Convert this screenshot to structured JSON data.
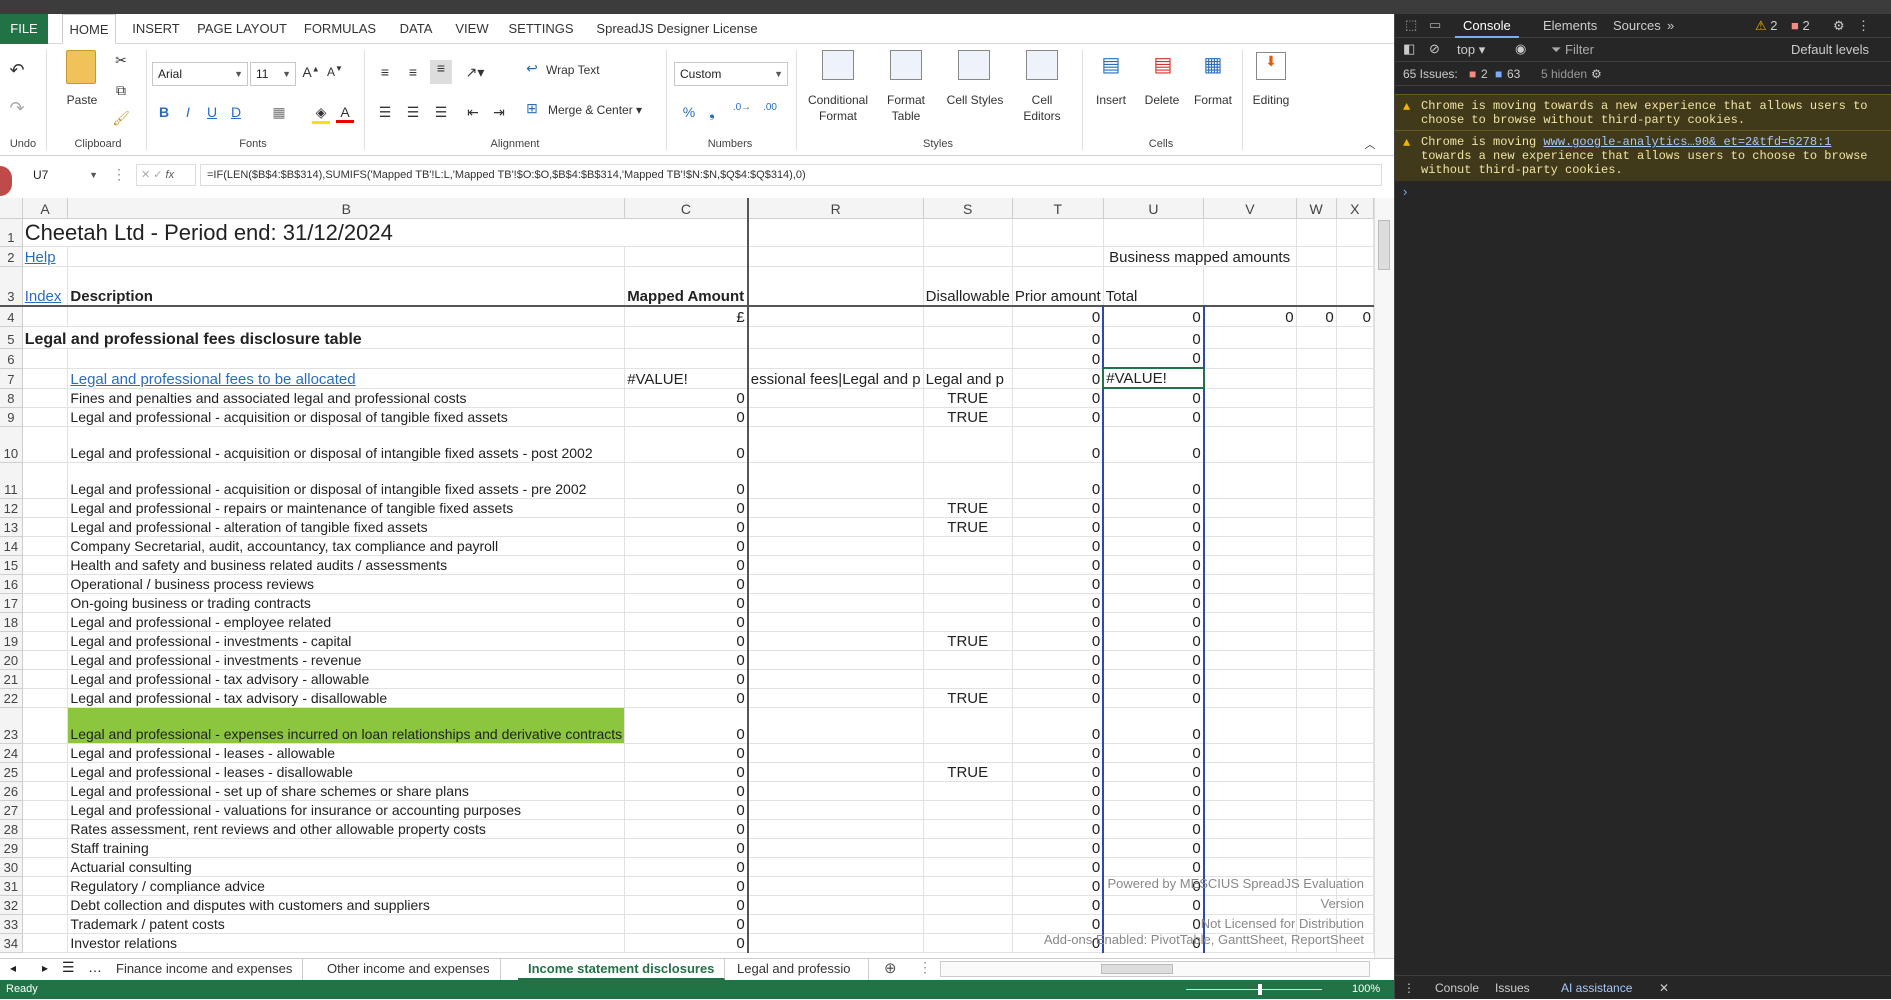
{
  "ribbon": {
    "file": "FILE",
    "tabs": [
      "HOME",
      "INSERT",
      "PAGE LAYOUT",
      "FORMULAS",
      "DATA",
      "VIEW",
      "SETTINGS",
      "SpreadJS Designer License"
    ],
    "groups": {
      "undo": "Undo",
      "clipboard": "Clipboard",
      "fonts": "Fonts",
      "alignment": "Alignment",
      "numbers": "Numbers",
      "styles": "Styles",
      "cells": "Cells"
    },
    "paste": "Paste",
    "font_name": "Arial",
    "font_size": "11",
    "wrap_text": "Wrap Text",
    "merge_center": "Merge & Center",
    "number_format": "Custom",
    "conditional_format": "Conditional Format",
    "format_table": "Format Table",
    "cell_styles": "Cell Styles",
    "cell_editors": "Cell Editors",
    "insert": "Insert",
    "delete": "Delete",
    "format": "Format",
    "editing": "Editing"
  },
  "formula_bar": {
    "name_box": "U7",
    "fx": "fx",
    "formula": "=IF(LEN($B$4:$B$314),SUMIFS('Mapped TB'!L:L,'Mapped TB'!$O:$O,$B$4:$B$314,'Mapped TB'!$N:$N,$Q$4:$Q$314),0)"
  },
  "grid": {
    "columns": [
      "A",
      "B",
      "C",
      "R",
      "S",
      "T",
      "U",
      "V",
      "W",
      "X"
    ],
    "title": "Cheetah Ltd - Period end: 31/12/2024",
    "help": "Help",
    "business_mapped": "Business mapped amounts",
    "index": "Index",
    "description": "Description",
    "mapped_amount": "Mapped Amount",
    "disallowable": "Disallowable",
    "prior_amount": "Prior amount",
    "total": "Total",
    "currency": "£",
    "row4": {
      "T": "0",
      "U": "0",
      "V": "0",
      "W": "0",
      "X": "0"
    },
    "section_title": "Legal and professional fees disclosure table",
    "row7": {
      "B": "Legal and professional fees to be allocated",
      "C": "#VALUE!",
      "R": "essional fees|Legal and p",
      "S": "Legal and p",
      "T": "0",
      "U": "#VALUE!"
    },
    "rows": [
      {
        "n": "8",
        "b": "Fines and penalties and associated legal and professional costs",
        "c": "0",
        "s": "TRUE",
        "t": "0",
        "u": "0"
      },
      {
        "n": "9",
        "b": "Legal and professional - acquisition or disposal of tangible fixed assets",
        "c": "0",
        "s": "TRUE",
        "t": "0",
        "u": "0"
      },
      {
        "n": "10",
        "b": "Legal and professional - acquisition or disposal of intangible fixed assets - post 2002",
        "c": "0",
        "s": "",
        "t": "0",
        "u": "0"
      },
      {
        "n": "11",
        "b": "Legal and professional - acquisition or disposal of intangible fixed assets - pre 2002",
        "c": "0",
        "s": "",
        "t": "0",
        "u": "0"
      },
      {
        "n": "12",
        "b": "Legal and professional - repairs or maintenance of tangible fixed assets",
        "c": "0",
        "s": "TRUE",
        "t": "0",
        "u": "0"
      },
      {
        "n": "13",
        "b": "Legal and professional - alteration of tangible fixed assets",
        "c": "0",
        "s": "TRUE",
        "t": "0",
        "u": "0"
      },
      {
        "n": "14",
        "b": "Company Secretarial, audit, accountancy, tax compliance and payroll",
        "c": "0",
        "s": "",
        "t": "0",
        "u": "0"
      },
      {
        "n": "15",
        "b": "Health and safety and business related audits / assessments",
        "c": "0",
        "s": "",
        "t": "0",
        "u": "0"
      },
      {
        "n": "16",
        "b": "Operational / business process reviews",
        "c": "0",
        "s": "",
        "t": "0",
        "u": "0"
      },
      {
        "n": "17",
        "b": "On-going business or trading contracts",
        "c": "0",
        "s": "",
        "t": "0",
        "u": "0"
      },
      {
        "n": "18",
        "b": "Legal and professional - employee related",
        "c": "0",
        "s": "",
        "t": "0",
        "u": "0"
      },
      {
        "n": "19",
        "b": "Legal and professional - investments - capital",
        "c": "0",
        "s": "TRUE",
        "t": "0",
        "u": "0"
      },
      {
        "n": "20",
        "b": "Legal and professional - investments - revenue",
        "c": "0",
        "s": "",
        "t": "0",
        "u": "0"
      },
      {
        "n": "21",
        "b": "Legal and professional - tax advisory - allowable",
        "c": "0",
        "s": "",
        "t": "0",
        "u": "0"
      },
      {
        "n": "22",
        "b": "Legal and professional - tax advisory - disallowable",
        "c": "0",
        "s": "TRUE",
        "t": "0",
        "u": "0"
      },
      {
        "n": "23",
        "b": "Legal and professional - expenses incurred on loan relationships and derivative contracts",
        "c": "0",
        "s": "",
        "t": "0",
        "u": "0"
      },
      {
        "n": "24",
        "b": "Legal and professional - leases - allowable",
        "c": "0",
        "s": "",
        "t": "0",
        "u": "0"
      },
      {
        "n": "25",
        "b": "Legal and professional - leases - disallowable",
        "c": "0",
        "s": "TRUE",
        "t": "0",
        "u": "0"
      },
      {
        "n": "26",
        "b": "Legal and professional - set up of share schemes or share plans",
        "c": "0",
        "s": "",
        "t": "0",
        "u": "0"
      },
      {
        "n": "27",
        "b": "Legal and professional - valuations for insurance or accounting purposes",
        "c": "0",
        "s": "",
        "t": "0",
        "u": "0"
      },
      {
        "n": "28",
        "b": "Rates assessment, rent reviews and other allowable property costs",
        "c": "0",
        "s": "",
        "t": "0",
        "u": "0"
      },
      {
        "n": "29",
        "b": "Staff training",
        "c": "0",
        "s": "",
        "t": "0",
        "u": "0"
      },
      {
        "n": "30",
        "b": "Actuarial consulting",
        "c": "0",
        "s": "",
        "t": "0",
        "u": "0"
      },
      {
        "n": "31",
        "b": "Regulatory / compliance advice",
        "c": "0",
        "s": "",
        "t": "0",
        "u": "0"
      },
      {
        "n": "32",
        "b": "Debt collection and disputes with customers and suppliers",
        "c": "0",
        "s": "",
        "t": "0",
        "u": "0"
      },
      {
        "n": "33",
        "b": "Trademark / patent costs",
        "c": "0",
        "s": "",
        "t": "0",
        "u": "0"
      },
      {
        "n": "34",
        "b": "Investor relations",
        "c": "0",
        "s": "",
        "t": "0",
        "u": "0"
      }
    ],
    "watermark1": "Powered by MESCIUS SpreadJS Evaluation Version",
    "watermark2": "Not Licensed for Distribution",
    "addons": "Add-ons Enabled: PivotTable, GanttSheet, ReportSheet"
  },
  "sheet_tabs": [
    "Finance income and expenses",
    "Other income and expenses",
    "Income statement disclosures",
    "Legal and professio"
  ],
  "status": {
    "ready": "Ready",
    "zoom": "100%"
  },
  "devtools": {
    "tabs": [
      "Console",
      "Elements",
      "Sources"
    ],
    "warn_count": "2",
    "err_count": "2",
    "context": "top",
    "filter": "Filter",
    "levels": "Default levels",
    "issues": "65 Issues:",
    "issues_err": "2",
    "issues_info": "63",
    "hidden": "5 hidden",
    "msg1": "Chrome is moving towards a new experience that allows users to choose to browse without third-party cookies.",
    "msg2_a": "Chrome is moving",
    "msg2_link": "www.google-analytics…90& et=2&tfd=6278:1",
    "msg2_b": "towards a new experience that allows users to choose to browse without third-party cookies.",
    "drawer": [
      "Console",
      "Issues",
      "AI assistance"
    ]
  }
}
